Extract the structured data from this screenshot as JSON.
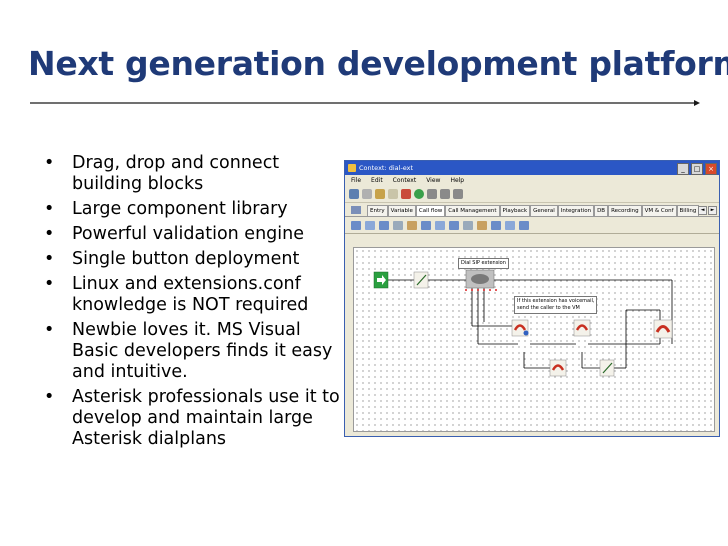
{
  "slide": {
    "title": "Next generation development platform",
    "bullets": [
      "Drag, drop and connect building blocks",
      "Large component library",
      "Powerful validation engine",
      "Single button deployment",
      "Linux and extensions.conf knowledge is NOT required",
      "Newbie loves it. MS Visual Basic developers finds it easy and intuitive.",
      "Asterisk professionals use it to develop and maintain large Asterisk dialplans"
    ],
    "bullet_char": "•",
    "colors": {
      "title": "#1f3a78",
      "titlebar": "#2b57c5"
    }
  },
  "app": {
    "window_title": "Context: dial-ext",
    "menu": [
      "File",
      "Edit",
      "Context",
      "View",
      "Help"
    ],
    "tabs": [
      "Entry",
      "Variable",
      "Call flow",
      "Call Management",
      "Playback",
      "General",
      "Integration",
      "DB",
      "Recording",
      "VM & Conf",
      "Billing"
    ],
    "active_tab": "Call flow",
    "window_buttons": {
      "minimize": "_",
      "maximize": "□",
      "close": "×"
    },
    "tab_scroll": {
      "left": "◄",
      "right": "►"
    },
    "callouts": {
      "dial_sip": "Dial SIP extension",
      "voicemail_line1": "If this extension has voicemail,",
      "voicemail_line2": "send the caller to the VM"
    },
    "icons": [
      "start-arrow-icon",
      "edit-note-icon",
      "dial-phone-icon",
      "phone-voicemail-icon",
      "phone-hangup-icon",
      "hangup-phone-icon",
      "edit-note-icon"
    ]
  }
}
